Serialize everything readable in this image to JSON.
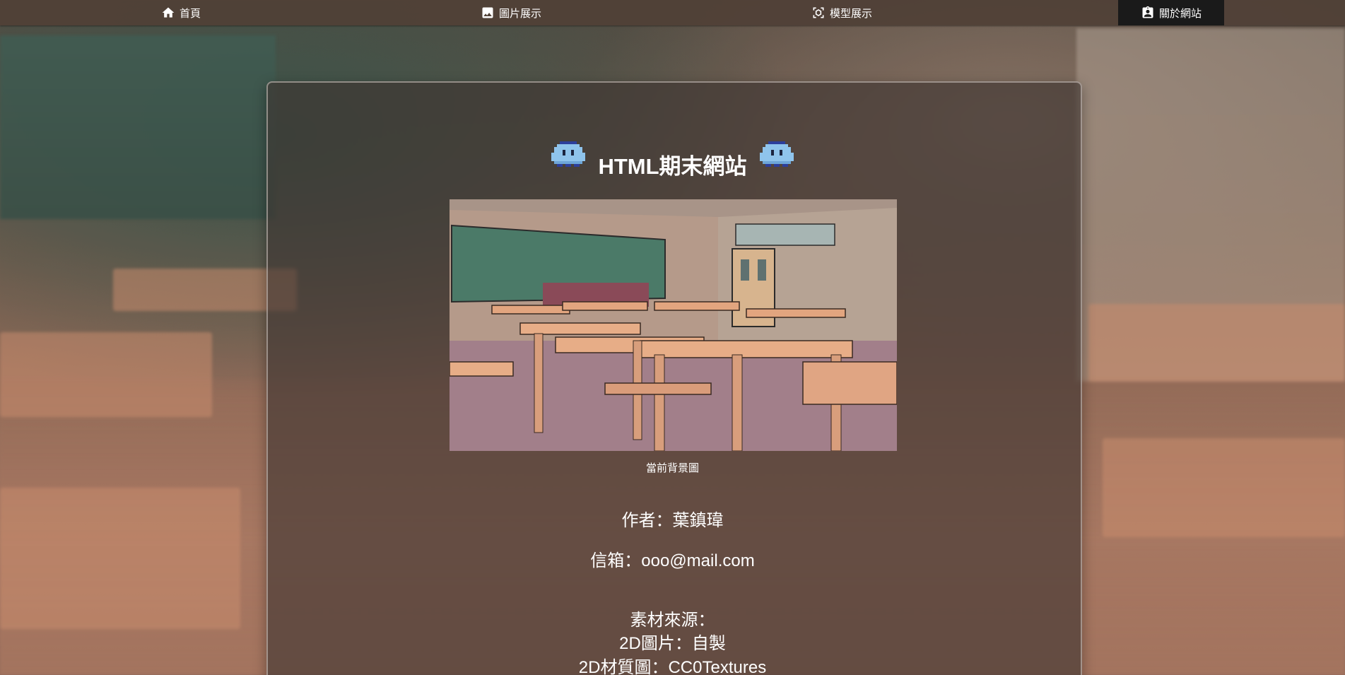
{
  "nav": {
    "items": [
      {
        "label": "首頁",
        "icon": "home-icon"
      },
      {
        "label": "圖片展示",
        "icon": "image-icon"
      },
      {
        "label": "模型展示",
        "icon": "model-view-icon"
      },
      {
        "label": "關於網站",
        "icon": "contact-card-icon",
        "active": true
      }
    ]
  },
  "main": {
    "title": "HTML期末網站",
    "preview_caption": "當前背景圖",
    "author": "作者：葉鎮瑋",
    "email": "信箱：ooo@mail.com",
    "sources_heading": "素材來源：",
    "source_2d_image": "2D圖片：自製",
    "source_2d_texture": "2D材質圖：CC0Textures"
  },
  "colors": {
    "nav_bg": "#50403a",
    "nav_active_bg": "#1a1a1a",
    "card_bg": "#3e3430",
    "sprite": "#8fc4ec"
  }
}
